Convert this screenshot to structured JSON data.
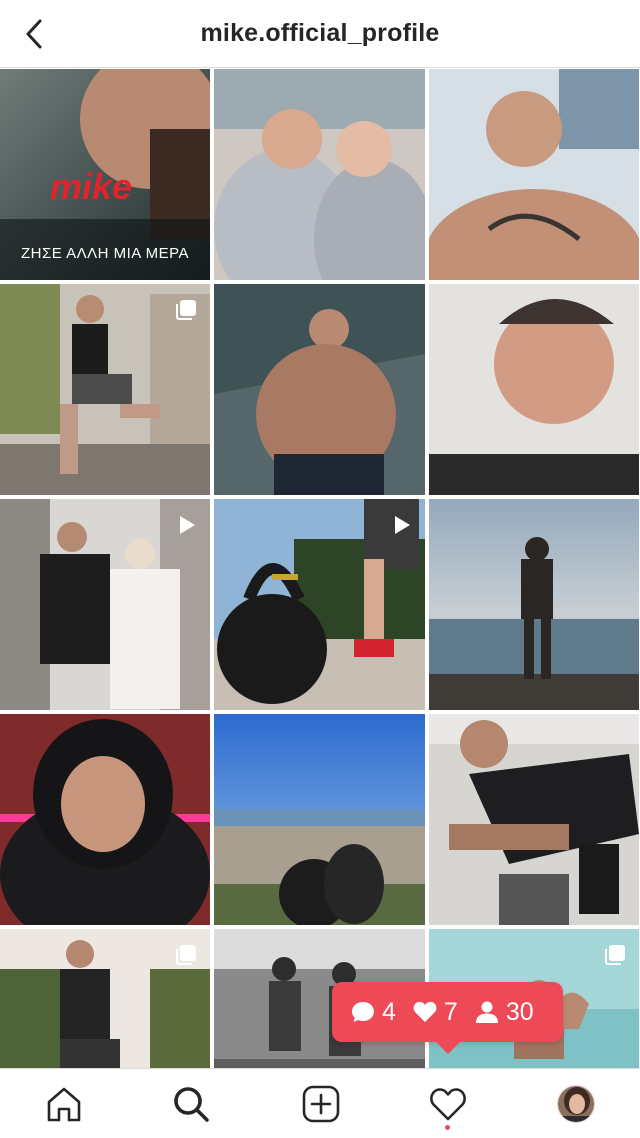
{
  "header": {
    "title": "mike.official_profile",
    "back_icon": "chevron-left-icon"
  },
  "posts": [
    {
      "id": 1,
      "subject": "close-up portrait promo",
      "logo_text": "mike",
      "caption": "ΖΗΣΕ ΑΛΛΗ ΜΙΑ ΜΕΡΑ",
      "multi": false,
      "video": false
    },
    {
      "id": 2,
      "subject": "couple selfie in hoodies",
      "multi": false,
      "video": false
    },
    {
      "id": 3,
      "subject": "tattooed shirtless selfie",
      "multi": false,
      "video": false
    },
    {
      "id": 4,
      "subject": "lunge on street",
      "multi": true,
      "video": false
    },
    {
      "id": 5,
      "subject": "seated in gym",
      "multi": false,
      "video": false
    },
    {
      "id": 6,
      "subject": "smiling close-up",
      "multi": false,
      "video": false
    },
    {
      "id": 7,
      "subject": "couple walking with masks",
      "multi": false,
      "video": true
    },
    {
      "id": 8,
      "subject": "kettlebell outdoors",
      "multi": false,
      "video": true
    },
    {
      "id": 9,
      "subject": "beach silhouette",
      "multi": false,
      "video": false
    },
    {
      "id": 10,
      "subject": "hooded smile neon",
      "multi": false,
      "video": false
    },
    {
      "id": 11,
      "subject": "city view from hill",
      "multi": false,
      "video": false
    },
    {
      "id": 12,
      "subject": "pose in gym",
      "multi": false,
      "video": false
    },
    {
      "id": 13,
      "subject": "kettlebell squat outdoors",
      "multi": true,
      "video": false
    },
    {
      "id": 14,
      "subject": "black and white beach duo",
      "multi": false,
      "video": false
    },
    {
      "id": 15,
      "subject": "flexing in sea",
      "multi": true,
      "video": false
    }
  ],
  "notification": {
    "comments": "4",
    "likes": "7",
    "follows": "30",
    "color": "#ed4956"
  },
  "tabbar": {
    "icons": [
      "home-icon",
      "search-icon",
      "add-post-icon",
      "heart-icon",
      "profile-avatar"
    ]
  }
}
